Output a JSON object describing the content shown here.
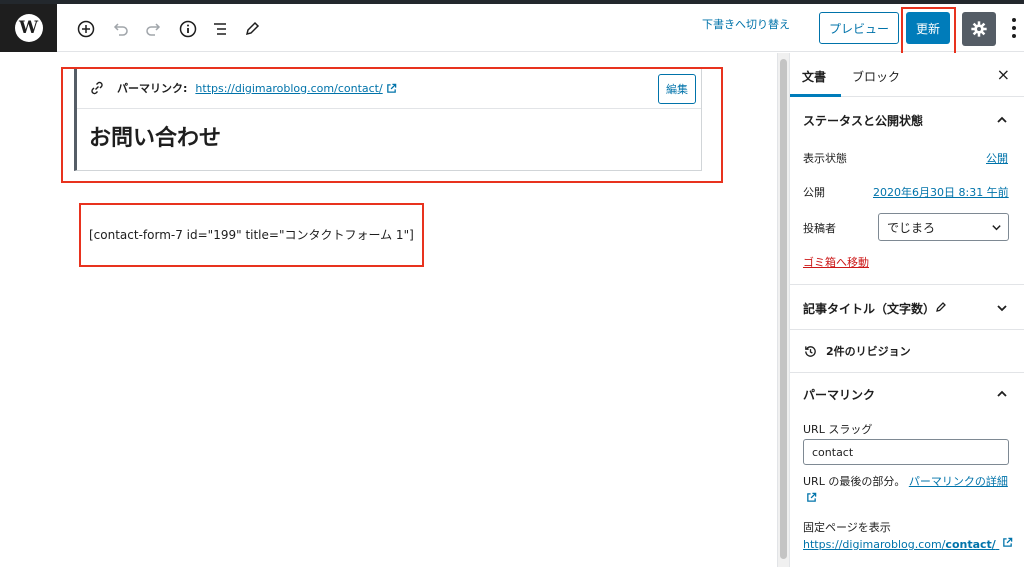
{
  "toolbar": {
    "draft_switch": "下書きへ切り替え",
    "preview": "プレビュー",
    "update": "更新"
  },
  "editor": {
    "permalink_label": "パーマリンク:",
    "permalink_url": "https://digimaroblog.com/contact/",
    "edit_button": "編集",
    "title": "お問い合わせ",
    "shortcode": "[contact-form-7 id=\"199\" title=\"コンタクトフォーム 1\"]"
  },
  "sidebar": {
    "tab_document": "文書",
    "tab_block": "ブロック",
    "close": "×",
    "status_panel": {
      "title": "ステータスと公開状態",
      "visibility_label": "表示状態",
      "visibility_value": "公開",
      "publish_label": "公開",
      "publish_value": "2020年6月30日 8:31 午前",
      "author_label": "投稿者",
      "author_value": "でじまろ",
      "trash": "ゴミ箱へ移動"
    },
    "title_panel": {
      "title": "記事タイトル（文字数）"
    },
    "revisions": "2件のリビジョン",
    "permalink_panel": {
      "title": "パーマリンク",
      "slug_label": "URL スラッグ",
      "slug_value": "contact",
      "help_text": "URL の最後の部分。",
      "help_link": "パーマリンクの詳細",
      "view_label": "固定ページを表示",
      "view_url_prefix": "https://digimaroblog.com/",
      "view_url_slug": "contact/"
    }
  },
  "colors": {
    "accent": "#007cba",
    "annotation": "#e8321e",
    "link": "#0073aa",
    "danger": "#cc1818"
  }
}
